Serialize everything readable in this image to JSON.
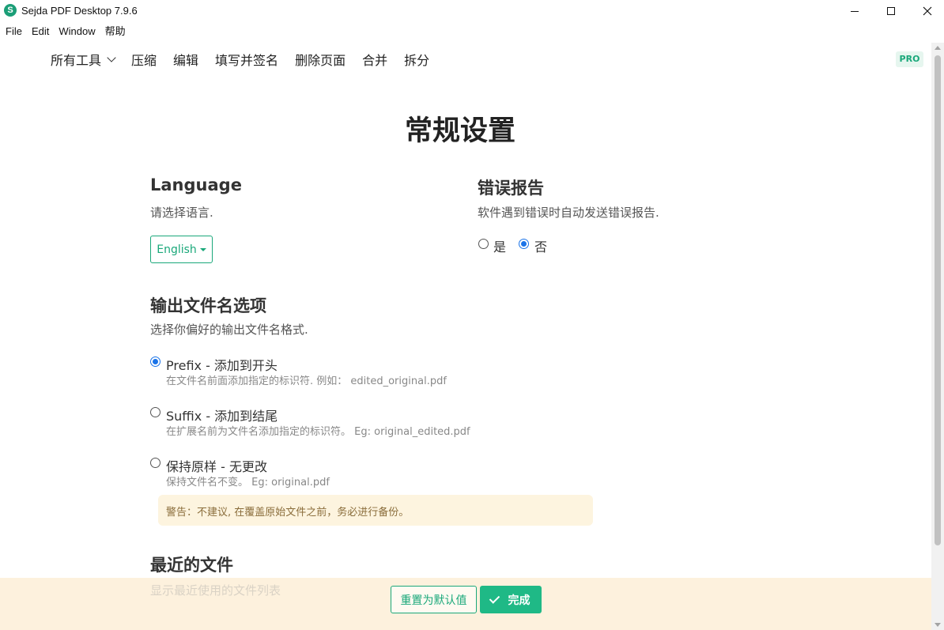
{
  "window": {
    "title": "Sejda PDF Desktop 7.9.6",
    "icon_letter": "S"
  },
  "menu": [
    "File",
    "Edit",
    "Window",
    "帮助"
  ],
  "nav": {
    "all_tools": "所有工具",
    "items": [
      "压缩",
      "编辑",
      "填写并签名",
      "删除页面",
      "合并",
      "拆分"
    ],
    "pro_badge": "PRO"
  },
  "page": {
    "title": "常规设置"
  },
  "language": {
    "heading": "Language",
    "description": "请选择语言.",
    "selected": "English"
  },
  "error_report": {
    "heading": "错误报告",
    "description": "软件遇到错误时自动发送错误报告.",
    "options": [
      "是",
      "否"
    ],
    "selected": "否"
  },
  "output_filename": {
    "heading": "输出文件名选项",
    "description": "选择你偏好的输出文件名格式.",
    "options": [
      {
        "label": "Prefix - 添加到开头",
        "sub": "在文件名前面添加指定的标识符. 例如： edited_original.pdf",
        "checked": true
      },
      {
        "label": "Suffix - 添加到结尾",
        "sub": "在扩展名前为文件名添加指定的标识符。 Eg: original_edited.pdf",
        "checked": false
      },
      {
        "label": "保持原样 - 无更改",
        "sub": "保持文件名不变。 Eg: original.pdf",
        "checked": false
      }
    ],
    "warning": "警告：不建议, 在覆盖原始文件之前，务必进行备份。"
  },
  "recent_files": {
    "heading": "最近的文件",
    "description": "显示最近使用的文件列表"
  },
  "footer": {
    "reset_label": "重置为默认值",
    "done_label": "完成"
  },
  "colors": {
    "accent": "#1aa87a",
    "radio_checked": "#1a73e8",
    "warning_bg": "#fdf4df",
    "footer_bg": "#fdf0da"
  }
}
